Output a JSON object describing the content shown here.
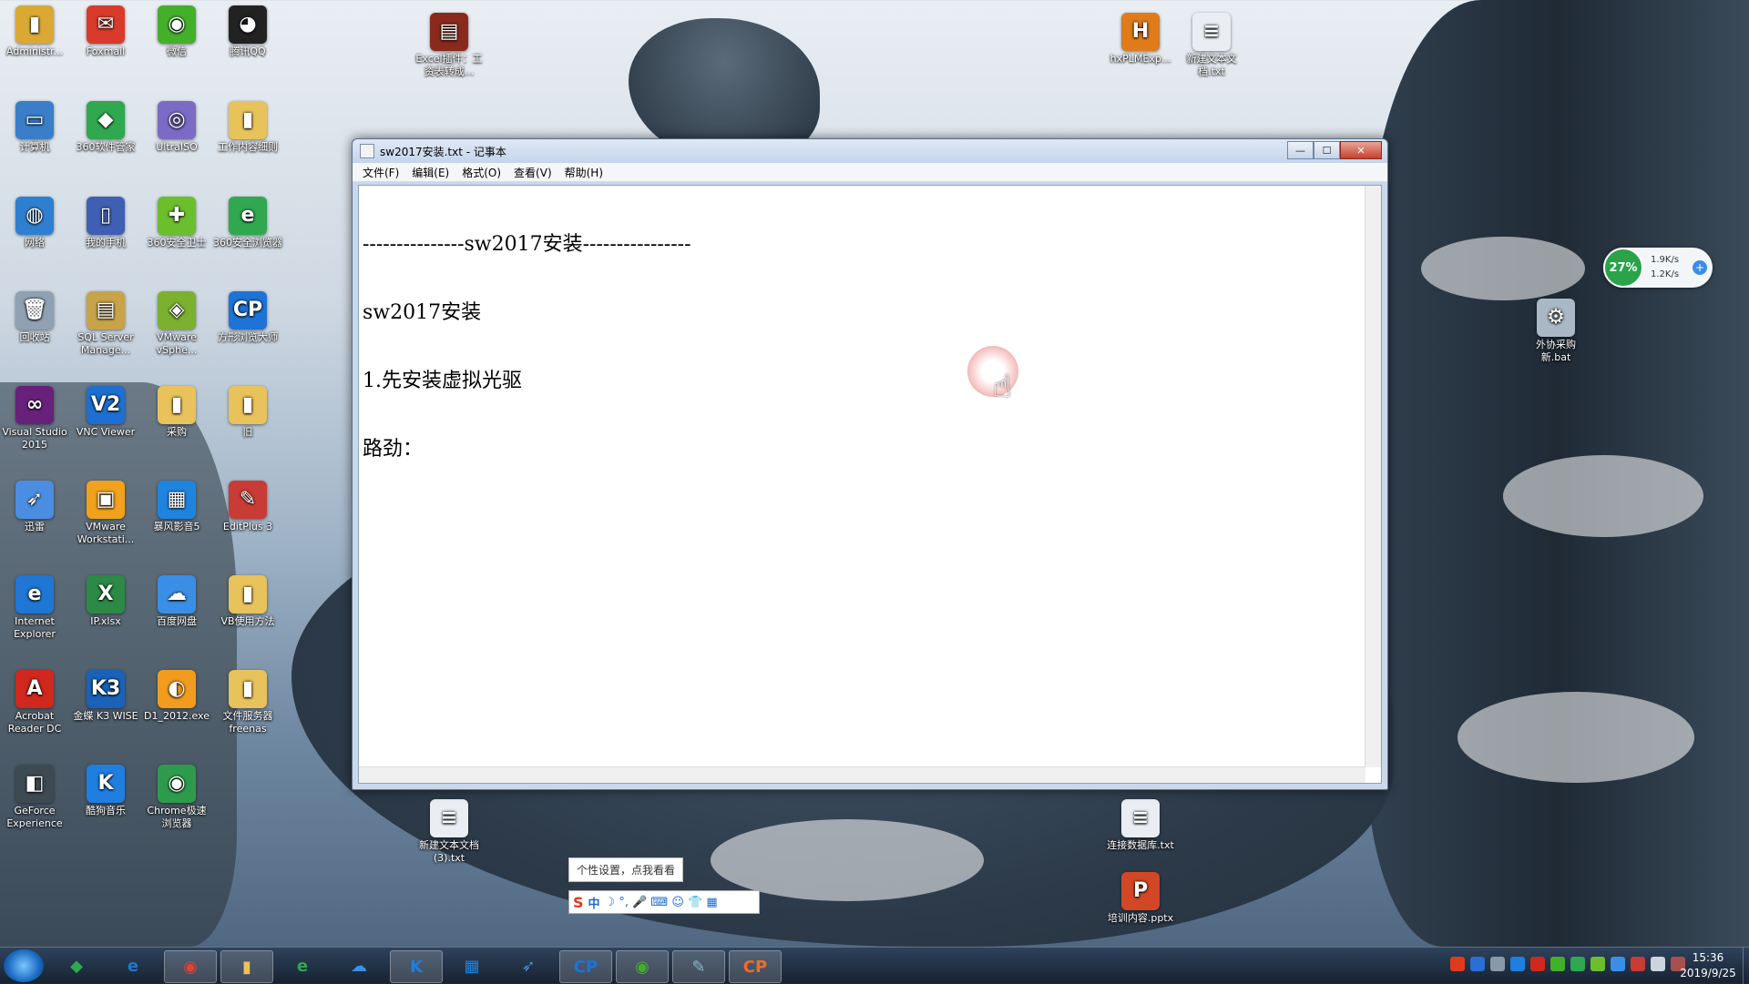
{
  "desktop": {
    "icons": [
      {
        "label": "Administr...",
        "color": "#d9a934",
        "glyph": "▮"
      },
      {
        "label": "Foxmail",
        "color": "#d93a2b",
        "glyph": "✉"
      },
      {
        "label": "微信",
        "color": "#43b02a",
        "glyph": "◉"
      },
      {
        "label": "腾讯QQ",
        "color": "#222222",
        "glyph": "◕"
      },
      {
        "label": "计算机",
        "color": "#3a7ec9",
        "glyph": "▭"
      },
      {
        "label": "360软件管家",
        "color": "#2fa84f",
        "glyph": "◆"
      },
      {
        "label": "UltraISO",
        "color": "#7b6bc7",
        "glyph": "◎"
      },
      {
        "label": "工作内容细则",
        "color": "#e8c25a",
        "glyph": "▮"
      },
      {
        "label": "网络",
        "color": "#2f7fd1",
        "glyph": "◍"
      },
      {
        "label": "我的手机",
        "color": "#3f5fb4",
        "glyph": "▯"
      },
      {
        "label": "360安全卫士",
        "color": "#6cbf2c",
        "glyph": "✚"
      },
      {
        "label": "360安全浏览器",
        "color": "#2fa84f",
        "glyph": "e"
      },
      {
        "label": "回收站",
        "color": "#8fa1b3",
        "glyph": "🗑"
      },
      {
        "label": "SQL Server Manage...",
        "color": "#c9a34a",
        "glyph": "▤"
      },
      {
        "label": "VMware vSphe...",
        "color": "#7bb12f",
        "glyph": "◈"
      },
      {
        "label": "方形浏览大师",
        "color": "#1d73d6",
        "glyph": "CP"
      },
      {
        "label": "Visual Studio 2015",
        "color": "#68217a",
        "glyph": "∞"
      },
      {
        "label": "VNC Viewer",
        "color": "#1e6fd1",
        "glyph": "V2"
      },
      {
        "label": "采购",
        "color": "#e8c25a",
        "glyph": "▮"
      },
      {
        "label": "旧",
        "color": "#e8c25a",
        "glyph": "▮"
      },
      {
        "label": "迅雷",
        "color": "#4b8de0",
        "glyph": "➶"
      },
      {
        "label": "VMware Workstati...",
        "color": "#f1a11c",
        "glyph": "▣"
      },
      {
        "label": "暴风影音5",
        "color": "#1e84e0",
        "glyph": "▦"
      },
      {
        "label": "EditPlus 3",
        "color": "#c93b35",
        "glyph": "✎"
      },
      {
        "label": "Internet Explorer",
        "color": "#1f76d3",
        "glyph": "e"
      },
      {
        "label": "IP.xlsx",
        "color": "#2c8a46",
        "glyph": "X"
      },
      {
        "label": "百度网盘",
        "color": "#3b8ee6",
        "glyph": "☁"
      },
      {
        "label": "VB使用方法",
        "color": "#e8c25a",
        "glyph": "▮"
      },
      {
        "label": "Acrobat Reader DC",
        "color": "#d0271e",
        "glyph": "A"
      },
      {
        "label": "金蝶 K3 WISE",
        "color": "#1a62b8",
        "glyph": "K3"
      },
      {
        "label": "D1_2012.exe",
        "color": "#f29c1f",
        "glyph": "◐"
      },
      {
        "label": "文件服务器 freenas",
        "color": "#e8c25a",
        "glyph": "▮"
      },
      {
        "label": "GeForce Experience",
        "color": "#3e4a52",
        "glyph": "◧"
      },
      {
        "label": "酷狗音乐",
        "color": "#1f7fe0",
        "glyph": "K"
      },
      {
        "label": "Chrome极速浏览器",
        "color": "#2e9b4c",
        "glyph": "◉"
      },
      {
        "label": "Excel插件：工资表转成...",
        "color": "#8a2a1c",
        "glyph": "▤"
      },
      {
        "label": "hxPLMExp...",
        "color": "#e07b1a",
        "glyph": "H"
      },
      {
        "label": "新建文本文档.txt",
        "color": "#eaeef3",
        "glyph": "≡"
      },
      {
        "label": "外协采购新.bat",
        "color": "#aab8c6",
        "glyph": "⚙"
      },
      {
        "label": "新建文本文档(3).txt",
        "color": "#eaeef3",
        "glyph": "≡"
      },
      {
        "label": "连接数据库.txt",
        "color": "#eaeef3",
        "glyph": "≡"
      },
      {
        "label": "培训内容.pptx",
        "color": "#d24726",
        "glyph": "P"
      }
    ]
  },
  "notepad": {
    "title": "sw2017安装.txt - 记事本",
    "menu": [
      "文件(F)",
      "编辑(E)",
      "格式(O)",
      "查看(V)",
      "帮助(H)"
    ],
    "lines": [
      "---------------sw2017安装----------------",
      "sw2017安装",
      "1.先安装虚拟光驱",
      "路劲："
    ],
    "buttons": {
      "minimize": "—",
      "maximize": "☐",
      "close": "✕"
    }
  },
  "netmon": {
    "percent": "27%",
    "up": "1.9K/s",
    "down": "1.2K/s",
    "plus": "+"
  },
  "ime": {
    "tooltip": "个性设置，点我看看",
    "logo": "S",
    "mode": "中",
    "extras": "☽ °, 🎤 ⌨ ☺ 👕 ▦"
  },
  "taskbar": {
    "apps": [
      {
        "name": "360软件管家",
        "glyph": "◆",
        "color": "#2fa84f",
        "active": false
      },
      {
        "name": "Internet Explorer",
        "glyph": "e",
        "color": "#1f76d3",
        "active": false
      },
      {
        "name": "Chrome",
        "glyph": "◉",
        "color": "#e34133",
        "active": true
      },
      {
        "name": "资源管理器",
        "glyph": "▮",
        "color": "#e8c25a",
        "active": true
      },
      {
        "name": "360安全浏览器",
        "glyph": "e",
        "color": "#2fa84f",
        "active": false
      },
      {
        "name": "百度网盘",
        "glyph": "☁",
        "color": "#3b8ee6",
        "active": false
      },
      {
        "name": "酷狗音乐",
        "glyph": "K",
        "color": "#1f7fe0",
        "active": true
      },
      {
        "name": "暴风影音",
        "glyph": "▦",
        "color": "#1e84e0",
        "active": false
      },
      {
        "name": "迅雷",
        "glyph": "➶",
        "color": "#4b8de0",
        "active": false
      },
      {
        "name": "方形浏览大师",
        "glyph": "CP",
        "color": "#1d73d6",
        "active": true
      },
      {
        "name": "微信",
        "glyph": "◉",
        "color": "#43b02a",
        "active": true
      },
      {
        "name": "记事本",
        "glyph": "✎",
        "color": "#88b7c9",
        "active": true
      },
      {
        "name": "方形浏览大师-橙",
        "glyph": "CP",
        "color": "#f36c21",
        "active": true
      }
    ],
    "clock": {
      "time": "15:36",
      "date": "2019/9/25"
    }
  }
}
